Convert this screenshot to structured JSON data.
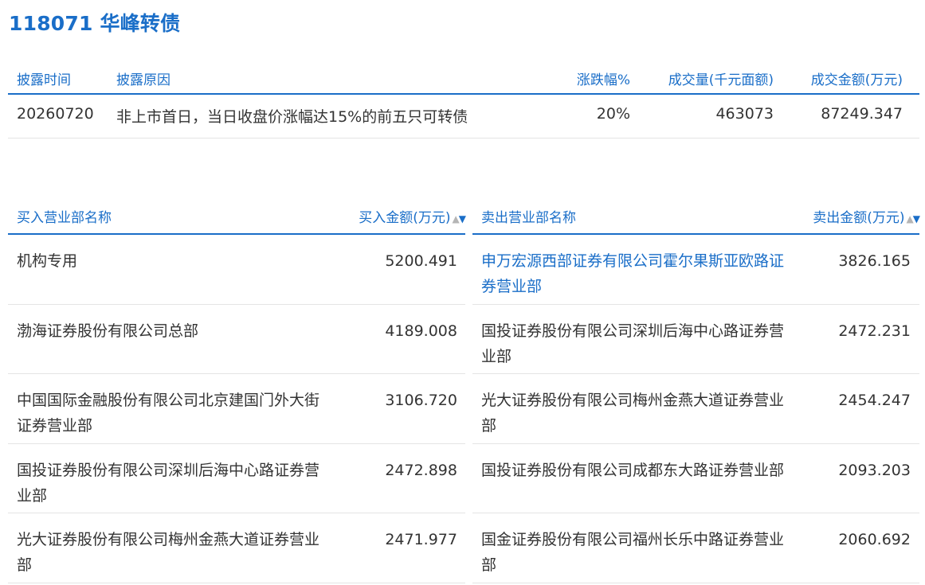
{
  "header": {
    "title": "118071 华峰转债"
  },
  "disclosure": {
    "columns": {
      "time": "披露时间",
      "reason": "披露原因",
      "change": "涨跌幅%",
      "volume": "成交量(千元面额)",
      "amount": "成交金额(万元)"
    },
    "rows": [
      {
        "time": "20260720",
        "reason": "非上市首日，当日收盘价涨幅达15%的前五只可转债",
        "change": "20%",
        "volume": "463073",
        "amount": "87249.347"
      }
    ]
  },
  "buy": {
    "name_header": "买入营业部名称",
    "amount_header": "买入金额(万元)",
    "sort_up": "▲",
    "sort_down": "▼",
    "rows": [
      {
        "name": "机构专用",
        "amount": "5200.491"
      },
      {
        "name": "渤海证券股份有限公司总部",
        "amount": "4189.008"
      },
      {
        "name": "中国国际金融股份有限公司北京建国门外大街证券营业部",
        "amount": "3106.720"
      },
      {
        "name": "国投证券股份有限公司深圳后海中心路证券营业部",
        "amount": "2472.898"
      },
      {
        "name": "光大证券股份有限公司梅州金燕大道证券营业部",
        "amount": "2471.977"
      }
    ]
  },
  "sell": {
    "name_header": "卖出营业部名称",
    "amount_header": "卖出金额(万元)",
    "sort_up": "▲",
    "sort_down": "▼",
    "rows": [
      {
        "name": "申万宏源西部证券有限公司霍尔果斯亚欧路证券营业部",
        "amount": "3826.165"
      },
      {
        "name": "国投证券股份有限公司深圳后海中心路证券营业部",
        "amount": "2472.231"
      },
      {
        "name": "光大证券股份有限公司梅州金燕大道证券营业部",
        "amount": "2454.247"
      },
      {
        "name": "国投证券股份有限公司成都东大路证券营业部",
        "amount": "2093.203"
      },
      {
        "name": "国金证券股份有限公司福州长乐中路证券营业部",
        "amount": "2060.692"
      }
    ]
  },
  "colors": {
    "accent": "#1a6ec8",
    "text": "#333333",
    "divider": "#e4e4e4",
    "sort_inactive": "#b5b5b5"
  }
}
